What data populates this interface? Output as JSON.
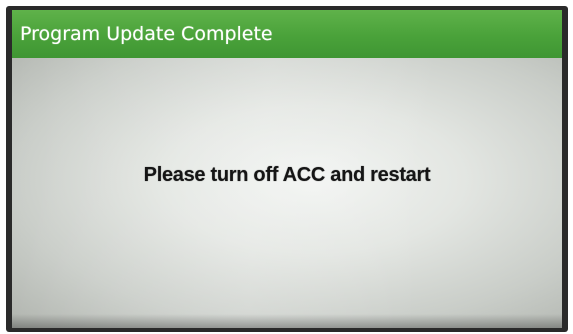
{
  "dialog": {
    "title": "Program Update Complete",
    "message": "Please turn off ACC and restart"
  },
  "colors": {
    "title_bar": "#4aa23a",
    "title_text": "#ffffff",
    "content_background": "#e3e6e2",
    "message_text": "#151515"
  }
}
